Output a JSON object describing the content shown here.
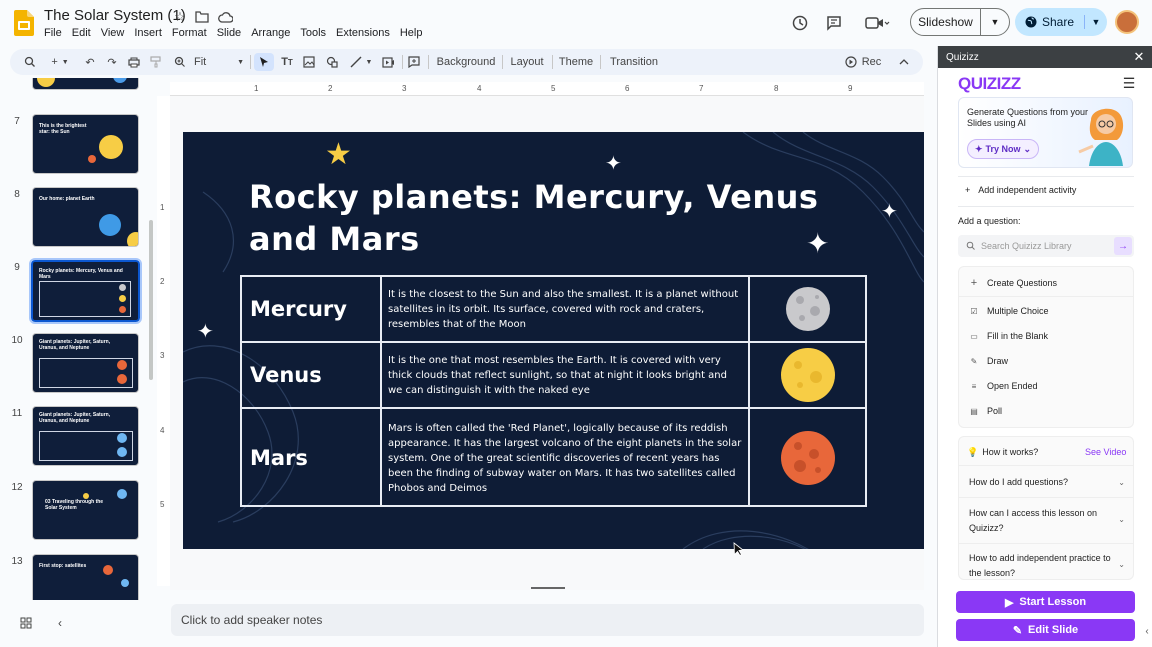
{
  "doc": {
    "title": "The Solar System (1)"
  },
  "menu": [
    "File",
    "Edit",
    "View",
    "Insert",
    "Format",
    "Slide",
    "Arrange",
    "Tools",
    "Extensions",
    "Help"
  ],
  "header": {
    "slideshow_label": "Slideshow",
    "share_label": "Share"
  },
  "toolbar": {
    "zoom_label": "Fit",
    "background": "Background",
    "layout": "Layout",
    "theme": "Theme",
    "transition": "Transition",
    "rec": "Rec"
  },
  "ruler": {
    "top": [
      "1",
      "2",
      "3",
      "4",
      "5",
      "6",
      "7",
      "8",
      "9"
    ],
    "left": [
      "1",
      "2",
      "3",
      "4",
      "5"
    ]
  },
  "filmstrip": [
    {
      "num": "7",
      "text": "This is the brightest star: the Sun"
    },
    {
      "num": "8",
      "text": "Our home: planet Earth"
    },
    {
      "num": "9",
      "text": "Rocky planets: Mercury, Venus and Mars"
    },
    {
      "num": "10",
      "text": "Giant planets: Jupiter, Saturn, Uranus, and Neptune"
    },
    {
      "num": "11",
      "text": "Giant planets: Jupiter, Saturn, Uranus, and Neptune"
    },
    {
      "num": "12",
      "text": "03 Traveling through the Solar System"
    },
    {
      "num": "13",
      "text": "First stop: satellites"
    }
  ],
  "slide": {
    "title": "Rocky planets: Mercury, Venus and Mars",
    "rows": [
      {
        "name": "Mercury",
        "desc": "It is the closest to the Sun and also the smallest. It is a planet without satellites in its orbit. Its surface, covered with rock and craters, resembles that of the Moon",
        "color": "#c9c9cc"
      },
      {
        "name": "Venus",
        "desc": "It is the one that most resembles the Earth. It is covered with very thick clouds that reflect sunlight, so that at night it looks bright and we can distinguish it with the naked eye",
        "color": "#f7cd45"
      },
      {
        "name": "Mars",
        "desc": "Mars is often called the 'Red Planet', logically because of its reddish appearance. It has the largest volcano of the eight planets in the solar system. One of the great scientific discoveries of recent years has been the finding of subway water on Mars. It has two satellites called Phobos and Deimos",
        "color": "#e8673a"
      }
    ]
  },
  "notes": {
    "placeholder": "Click to add speaker notes"
  },
  "quizizz": {
    "panel_title": "Quizizz",
    "logo": "QUIZIZZ",
    "banner_text": "Generate Questions from your Slides using AI",
    "try_label": "Try Now",
    "add_independent": "Add independent activity",
    "add_question_label": "Add a question:",
    "search_placeholder": "Search Quizizz Library",
    "create_questions": "Create Questions",
    "question_types": [
      "Multiple Choice",
      "Fill in the Blank",
      "Draw",
      "Open Ended",
      "Poll"
    ],
    "how_it_works": "How it works?",
    "see_video": "See Video",
    "faqs": [
      "How do I add questions?",
      "How can I access this lesson on Quizizz?",
      "How to add independent practice to the lesson?"
    ],
    "start_lesson": "Start Lesson",
    "edit_slide": "Edit Slide"
  },
  "colors": {
    "accent": "#0b57d0",
    "quizizz_purple": "#8a38f5",
    "slide_bg": "#0e1c36"
  }
}
